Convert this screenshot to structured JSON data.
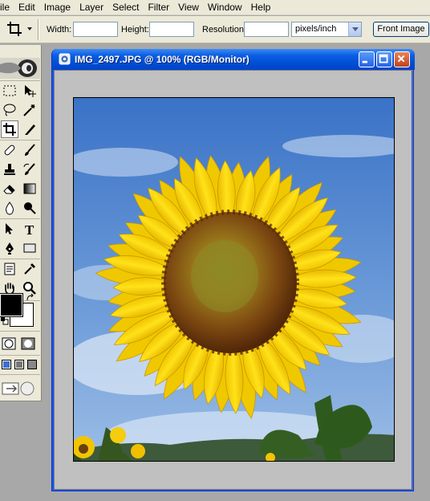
{
  "menubar": {
    "items": [
      "ile",
      "Edit",
      "Image",
      "Layer",
      "Select",
      "Filter",
      "View",
      "Window",
      "Help"
    ]
  },
  "options": {
    "width_label": "Width:",
    "width_value": "",
    "height_label": "Height:",
    "height_value": "",
    "resolution_label": "Resolution:",
    "resolution_value": "",
    "units_selected": "pixels/inch",
    "front_image_label": "Front Image"
  },
  "toolbox": {
    "tools": [
      "marquee-icon",
      "move-icon",
      "lasso-icon",
      "magic-wand-icon",
      "crop-icon",
      "eyedropper-slice-icon",
      "healing-brush-icon",
      "brush-icon",
      "clone-stamp-icon",
      "history-brush-icon",
      "eraser-icon",
      "gradient-icon",
      "blur-icon",
      "dodge-icon",
      "path-select-icon",
      "type-icon",
      "pen-icon",
      "shape-icon",
      "notes-icon",
      "eyedropper-icon",
      "hand-icon",
      "zoom-icon"
    ],
    "foreground_color": "#000000",
    "background_color": "#ffffff"
  },
  "document": {
    "title": "IMG_2497.JPG @ 100% (RGB/Monitor)",
    "image_subject": "sunflower-photo"
  },
  "colors": {
    "chrome": "#ece9d8",
    "workspace": "#a8a8a8",
    "titlebar": "#0054e3"
  }
}
